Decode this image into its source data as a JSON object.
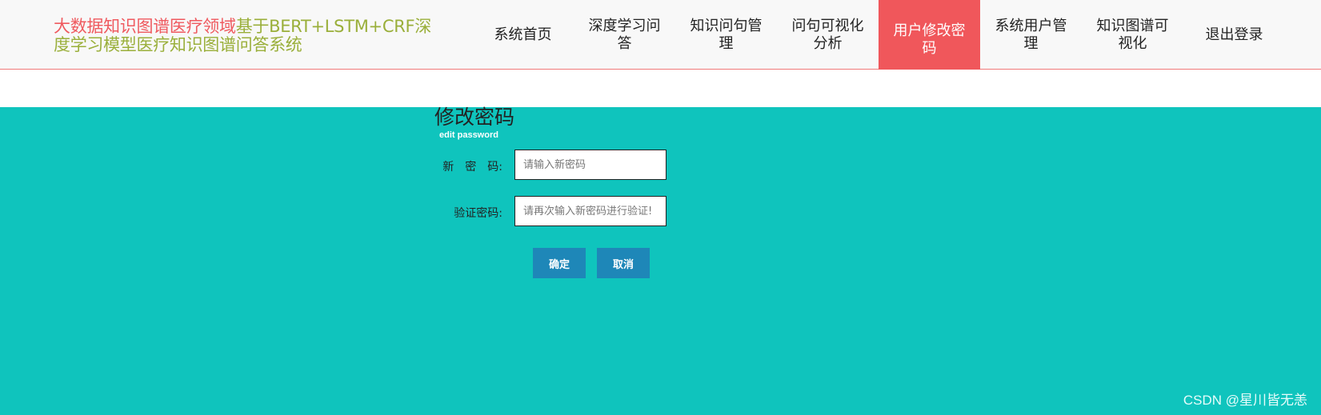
{
  "header": {
    "title_part1": "大数据知识图谱医疗领域",
    "title_part2": "基于BERT+LSTM+CRF深度学习模型医疗知识图谱问答系统"
  },
  "nav": {
    "items": [
      {
        "line1": "系统首页",
        "line2": ""
      },
      {
        "line1": "深度学习问",
        "line2": "答"
      },
      {
        "line1": "知识问句管",
        "line2": "理"
      },
      {
        "line1": "问句可视化",
        "line2": "分析"
      },
      {
        "line1": "用户修改密",
        "line2": "码"
      },
      {
        "line1": "系统用户管",
        "line2": "理"
      },
      {
        "line1": "知识图谱可",
        "line2": "视化"
      },
      {
        "line1": "退出登录",
        "line2": ""
      }
    ],
    "active_index": 4
  },
  "form": {
    "title": "修改密码",
    "subtitle": "edit password",
    "new_password_label": "新　密　码:",
    "new_password_placeholder": "请输入新密码",
    "new_password_value": "",
    "verify_password_label": "验证密码:",
    "verify_password_placeholder": "请再次输入新密码进行验证!",
    "verify_password_value": "",
    "confirm_label": "确定",
    "cancel_label": "取消"
  },
  "watermark": "CSDN @星川皆无恙",
  "colors": {
    "background": "#0fc4bd",
    "active_nav": "#f0575b",
    "button": "#1e87b8",
    "title_red": "#ef5a5f",
    "title_olive": "#9aaf3a"
  }
}
